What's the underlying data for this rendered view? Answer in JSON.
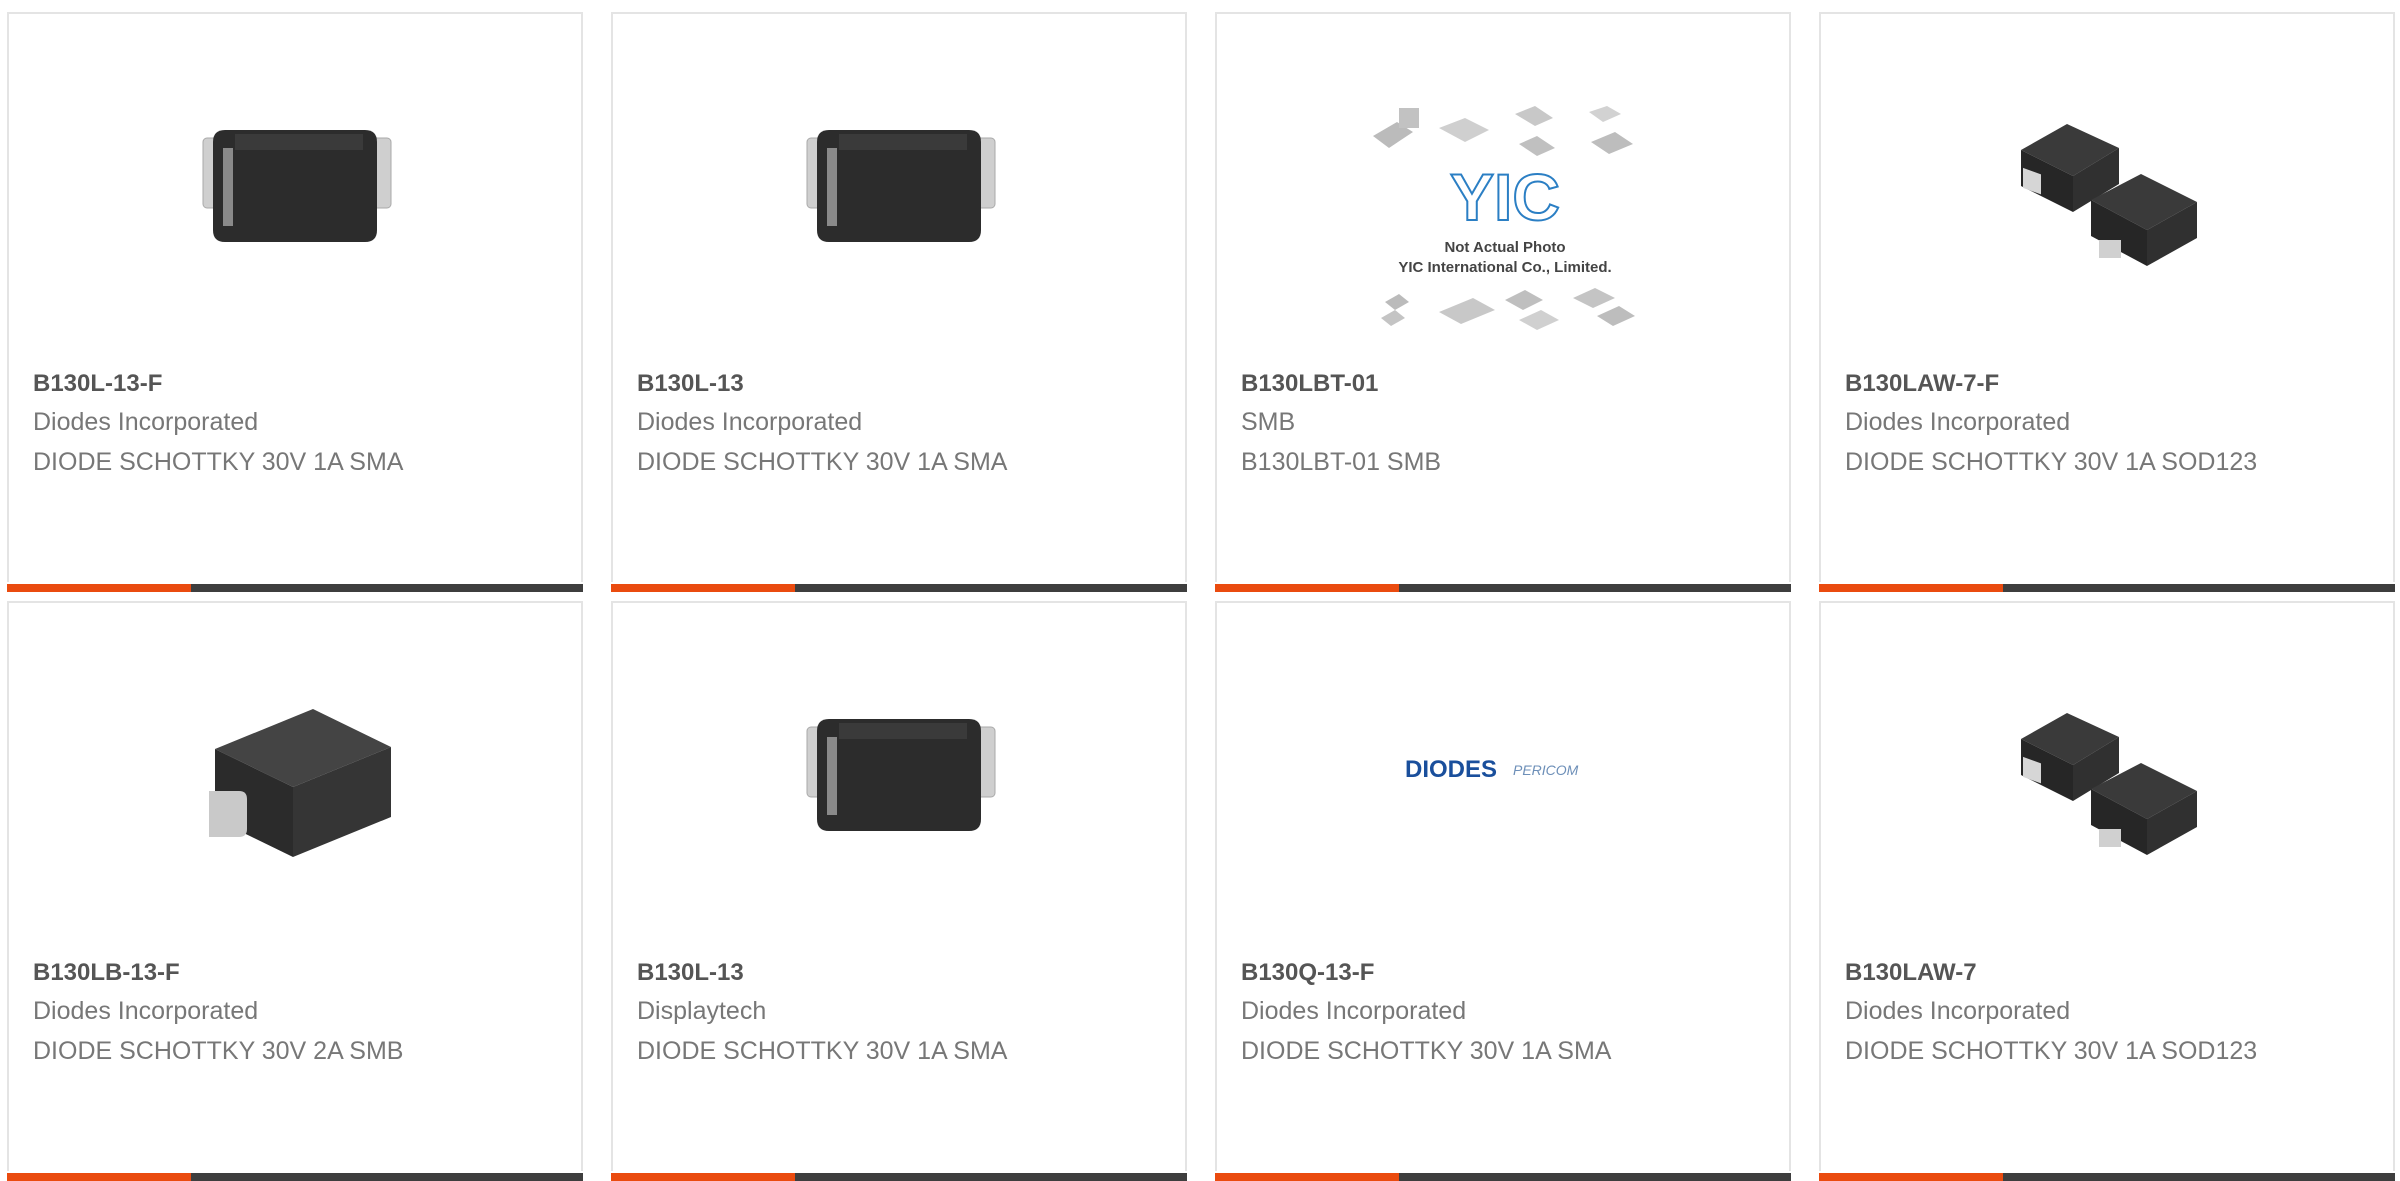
{
  "products": [
    {
      "part": "B130L-13-F",
      "manufacturer": "Diodes Incorporated",
      "description": "DIODE SCHOTTKY 30V 1A SMA",
      "image": "sma-diode-package"
    },
    {
      "part": "B130L-13",
      "manufacturer": "Diodes Incorporated",
      "description": "DIODE SCHOTTKY 30V 1A SMA",
      "image": "sma-diode-package"
    },
    {
      "part": "B130LBT-01",
      "manufacturer": "SMB",
      "description": "B130LBT-01 SMB",
      "image": "yic-placeholder",
      "placeholder_lines": [
        "Not Actual Photo",
        "YIC International Co., Limited."
      ]
    },
    {
      "part": "B130LAW-7-F",
      "manufacturer": "Diodes Incorporated",
      "description": "DIODE SCHOTTKY 30V 1A SOD123",
      "image": "sod123-package"
    },
    {
      "part": "B130LB-13-F",
      "manufacturer": "Diodes Incorporated",
      "description": "DIODE SCHOTTKY 30V 2A SMB",
      "image": "smb-diode-package"
    },
    {
      "part": "B130L-13",
      "manufacturer": "Displaytech",
      "description": "DIODE SCHOTTKY 30V 1A SMA",
      "image": "sma-diode-package"
    },
    {
      "part": "B130Q-13-F",
      "manufacturer": "Diodes Incorporated",
      "description": "DIODE SCHOTTKY 30V 1A SMA",
      "image": "diodes-pericom-logo",
      "logo_text": [
        "DIODES",
        "PERICOM"
      ]
    },
    {
      "part": "B130LAW-7",
      "manufacturer": "Diodes Incorporated",
      "description": "DIODE SCHOTTKY 30V 1A SOD123",
      "image": "sod123-package"
    }
  ],
  "colors": {
    "accent": "#ea4b0f",
    "bar": "#3e3e3e",
    "border": "#e4e4e4",
    "text": "#777777"
  }
}
